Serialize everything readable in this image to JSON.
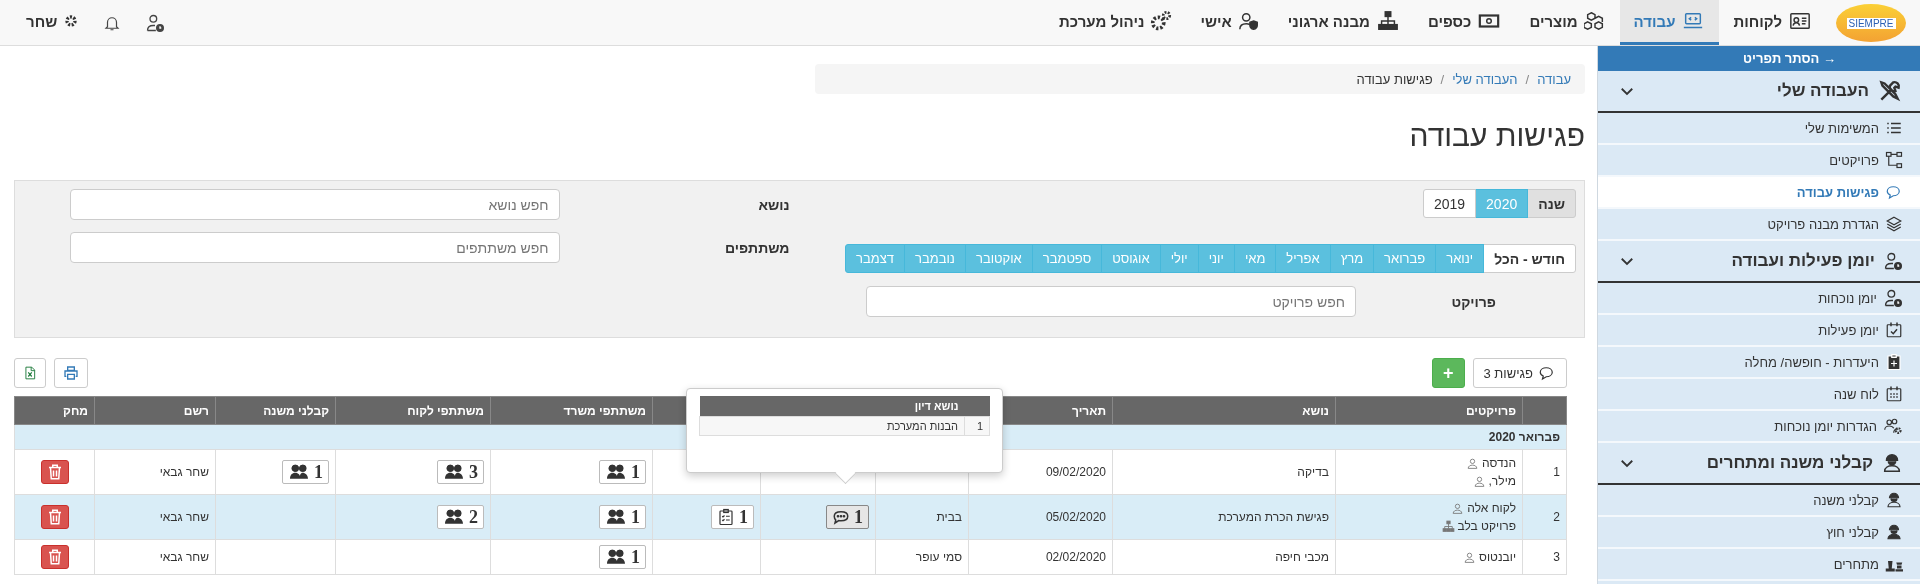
{
  "top_nav": {
    "logo": "SIEMPRE",
    "items": [
      {
        "label": "לקוחות",
        "selected": false
      },
      {
        "label": "עבודה",
        "selected": true
      },
      {
        "label": "מוצרים",
        "selected": false
      },
      {
        "label": "כספים",
        "selected": false
      },
      {
        "label": "מבנה ארגוני",
        "selected": false
      },
      {
        "label": "אישי",
        "selected": false
      },
      {
        "label": "ניהול מערכת",
        "selected": false
      }
    ],
    "user": {
      "name": "שחר"
    }
  },
  "sidebar": {
    "hide_label": "→ הסתר תפריט",
    "sections": [
      {
        "title": "העבודה שלי",
        "expanded": true,
        "items": [
          {
            "label": "המשימות שלי",
            "selected": false
          },
          {
            "label": "פרויקטים",
            "selected": false
          },
          {
            "label": "פגישות עבודה",
            "selected": true
          },
          {
            "label": "הגדרת מבנה פרויקט",
            "selected": false
          }
        ]
      },
      {
        "title": "יומן פעילות ועבודה",
        "expanded": true,
        "items": [
          {
            "label": "יומן נוכחות",
            "selected": false
          },
          {
            "label": "יומן פעילות",
            "selected": false
          },
          {
            "label": "היעדרות - חופשה/ מחלה",
            "selected": false
          },
          {
            "label": "לוח שנה",
            "selected": false
          },
          {
            "label": "הגדרות יומן נוכחות",
            "selected": false
          }
        ]
      },
      {
        "title": "קבלני משנה ומתחרים",
        "expanded": true,
        "items": [
          {
            "label": "קבלני משנה",
            "selected": false
          },
          {
            "label": "קבלני חוץ",
            "selected": false
          },
          {
            "label": "מתחרים",
            "selected": false
          }
        ]
      }
    ]
  },
  "breadcrumb": {
    "separator": "/",
    "items": [
      {
        "label": "עבודה",
        "link": true
      },
      {
        "label": "העבודה שלי",
        "link": true
      },
      {
        "label": "פגישות עבודה",
        "link": false
      }
    ]
  },
  "title": "פגישות עבודה",
  "filters": {
    "year": {
      "label": "שנה",
      "options": [
        {
          "label": "2020",
          "selected": true
        },
        {
          "label": "2019",
          "selected": false
        }
      ]
    },
    "months": {
      "label": "חודש - הכל",
      "options": [
        {
          "label": "ינואר",
          "selected": true
        },
        {
          "label": "פברואר",
          "selected": true
        },
        {
          "label": "מרץ",
          "selected": true
        },
        {
          "label": "אפריל",
          "selected": true
        },
        {
          "label": "מאי",
          "selected": true
        },
        {
          "label": "יוני",
          "selected": true
        },
        {
          "label": "יולי",
          "selected": true
        },
        {
          "label": "אוגוסט",
          "selected": true
        },
        {
          "label": "ספטמבר",
          "selected": true
        },
        {
          "label": "אוקטובר",
          "selected": true
        },
        {
          "label": "נובמבר",
          "selected": true
        },
        {
          "label": "דצמבר",
          "selected": true
        }
      ]
    },
    "project": {
      "label": "פרויקט",
      "placeholder": "חפש פרויקט"
    },
    "subject": {
      "label": "נושא",
      "placeholder": "חפש נושא"
    },
    "participants": {
      "label": "משתתפים",
      "placeholder": "חפש משתתפים"
    }
  },
  "toolbar": {
    "meetings_label": "פגישות 3",
    "add_label": "+"
  },
  "table": {
    "columns": [
      {},
      {
        "label": "פרויקטים"
      },
      {
        "label": "נושא"
      },
      {
        "label": "תאריך"
      },
      {},
      {},
      {},
      {
        "label": "משתתפי משרד"
      },
      {
        "label": "משתתפי לקוח"
      },
      {
        "label": "קבלני משנה"
      },
      {
        "label": "רשם"
      },
      {
        "label": "מחק"
      }
    ],
    "group": "פברואר 2020",
    "rows": [
      {
        "num": "1",
        "selected": false,
        "projects": [
          {
            "kind": "person",
            "label": "הנדסה"
          },
          {
            "kind": "person",
            "label": "מילר,"
          }
        ],
        "subject": "בדיקה",
        "date": "09/02/2020",
        "office": "1",
        "client": "3",
        "subs": "1",
        "registrar": "שחר גבאי"
      },
      {
        "num": "2",
        "selected": true,
        "projects": [
          {
            "kind": "person",
            "label": "לקוח אלה"
          },
          {
            "kind": "project",
            "label": "פרויקט בלב"
          }
        ],
        "subject": "פגישת הכרת המערכת",
        "date": "05/02/2020",
        "place": "בבית",
        "topics": "1",
        "tasks": "1",
        "office": "1",
        "client": "2",
        "registrar": "שחר גבאי"
      },
      {
        "num": "3",
        "selected": false,
        "projects": [
          {
            "kind": "person",
            "label": "יובנטוס"
          }
        ],
        "subject": "מכבי חיפה",
        "date": "02/02/2020",
        "place": "סמי עופר",
        "office": "1",
        "registrar": "שחר גבאי"
      }
    ]
  },
  "tooltip": {
    "column": "נושא דיון",
    "rows": [
      {
        "num": "1",
        "topic": "הבנות המערכת"
      }
    ]
  }
}
